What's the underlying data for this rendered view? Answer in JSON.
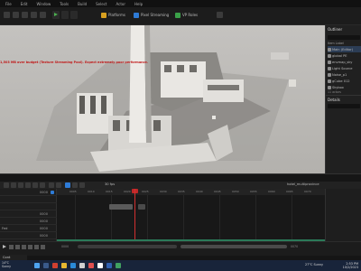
{
  "menubar": {
    "items": [
      "File",
      "Edit",
      "Window",
      "Tools",
      "Build",
      "Select",
      "Actor",
      "Help"
    ]
  },
  "toolbar": {
    "platforms_label": "Platforms",
    "pixel_streaming_label": "Pixel Streaming",
    "vp_roles_label": "VP Roles"
  },
  "viewport": {
    "warning_text": "1,503 MB over budget (Texture Streaming Pool). Expect extremely poor performance."
  },
  "outliner": {
    "title": "Outliner",
    "column_label": "Item Label",
    "items": [
      {
        "label": "Main (Editor)",
        "selected": true
      },
      {
        "label": "global PE"
      },
      {
        "label": "envmap_sky"
      },
      {
        "label": "Light Source"
      },
      {
        "label": "Noise_p1"
      },
      {
        "label": "gCube 012"
      },
      {
        "label": "Skybox"
      }
    ],
    "actor_count": "11 actors",
    "details_title": "Details"
  },
  "sequencer": {
    "fps_label": "30 fps",
    "sequence_name": "hotel_multiprovince",
    "time_value": "0000",
    "track_values": [
      "0000",
      "0000",
      "0000",
      "0000"
    ],
    "track_name": "Fed",
    "ruler_ticks": [
      "0005",
      "0010",
      "0015",
      "0020",
      "0025",
      "0030",
      "0035",
      "0040",
      "0045",
      "0050",
      "0055",
      "0060",
      "0065",
      "0070"
    ],
    "start_frame": "0000",
    "end_frame": "0070"
  },
  "content_browser": {
    "tab_label": "Cont"
  },
  "taskbar": {
    "weather_temp": "14°C",
    "weather_desc": "Sunny",
    "tray_text": "27°C  Sunny",
    "time": "2:53 PM",
    "date": "10/2/2023"
  },
  "colors": {
    "accent": "#2e7bd6",
    "playhead": "#d23030",
    "warning": "#c01818"
  }
}
